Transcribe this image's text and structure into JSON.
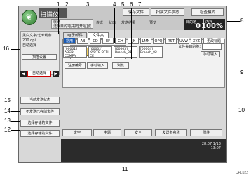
{
  "title": "扫描仪",
  "logo_glyph": "❦",
  "top_buttons": [
    "保存文件",
    "扫描文件状态",
    "检查模式"
  ],
  "status_items": [
    "传送",
    "状态",
    "发送结果",
    "预览"
  ],
  "ready_lines": [
    "就绪",
    "选择目的地并按[开始]键"
  ],
  "memory": {
    "label1": "目的地",
    "value1": "0",
    "label2": "内存",
    "value2": "100%"
  },
  "left_panel_lines": [
    "黑白文字/艺术线条",
    "200 dpi",
    "自动选择"
  ],
  "left_button": "扫描设置",
  "sort_label": "自动选择",
  "tabs": [
    "电子邮件",
    "文件夹"
  ],
  "registered_label": "文件夹目的地:",
  "manual_entry": "手动输入",
  "action_buttons": [
    "注册编号",
    "手动输入",
    "浏览"
  ],
  "index_buttons": [
    "常用",
    "AB",
    "CD",
    "EF",
    "GH",
    "IJK",
    "LMN",
    "OPQ",
    "RST",
    "UVW",
    "XYZ",
    "更改标题"
  ],
  "dest_cards": [
    {
      "line1": "[00001]",
      "line2": "ABCD COMPA",
      "line3": "NY"
    },
    {
      "line1": "[00002]",
      "line2": "KYOTO OFFI",
      "line3": "CE"
    },
    {
      "line1": "[00003]",
      "line2": "Branch_01",
      "line3": ""
    },
    {
      "line1": "[00004]",
      "line2": "Branch_02",
      "line3": ""
    }
  ],
  "side_buttons": [
    "当前发送状态",
    "不发送已存储文件",
    "选择存储的文件",
    "选择存储的文件"
  ],
  "bottom_tabs": [
    "文字",
    "主题",
    "安全",
    "发送者名称",
    "附件"
  ],
  "time_text": [
    "28.07 1/13",
    "13:07"
  ],
  "callouts": [
    "1",
    "2",
    "3",
    "4",
    "5",
    "6",
    "7",
    "8",
    "9",
    "10",
    "11",
    "12",
    "13",
    "14",
    "15",
    "16"
  ],
  "corner_code": "CPL022"
}
